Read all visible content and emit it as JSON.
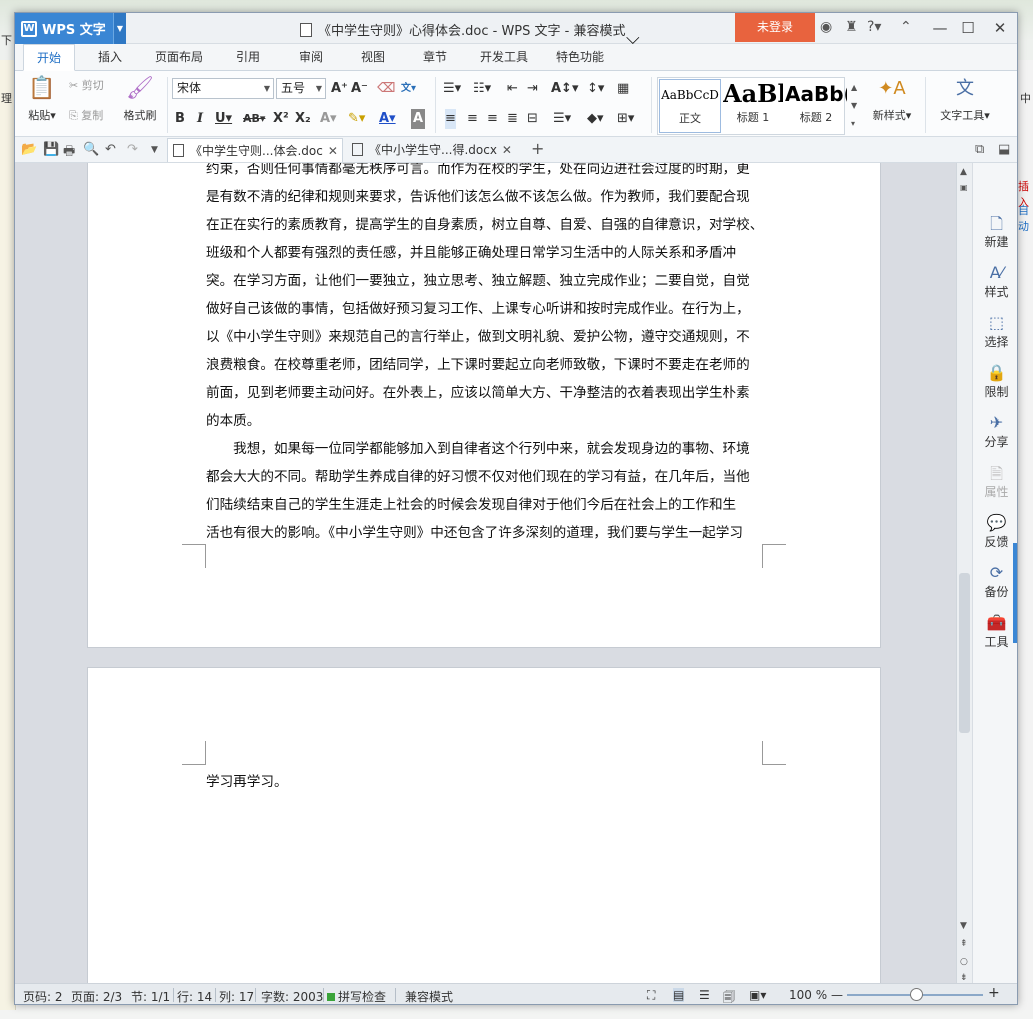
{
  "app": {
    "name": "WPS 文字",
    "window_title": "《中学生守则》心得体会.doc - WPS 文字 - 兼容模式",
    "login_label": "未登录"
  },
  "ribbon_tabs": [
    "开始",
    "插入",
    "页面布局",
    "引用",
    "审阅",
    "视图",
    "章节",
    "开发工具",
    "特色功能"
  ],
  "ribbon": {
    "paste": "粘贴",
    "cut": "剪切",
    "copy": "复制",
    "format_painter": "格式刷",
    "font_name": "宋体",
    "font_size": "五号",
    "styles": [
      {
        "sample": "AaBbCcD",
        "label": "正文"
      },
      {
        "sample": "AaBl",
        "label": "标题 1"
      },
      {
        "sample": "AaBb(",
        "label": "标题 2"
      }
    ],
    "new_style": "新样式",
    "text_tools": "文字工具"
  },
  "doc_tabs": [
    {
      "label": "《中学生守则...体会.doc"
    },
    {
      "label": "《中小学生守...得.docx"
    }
  ],
  "document": {
    "page1_lines": [
      "约束，否则任何事情都毫无秩序可言。而作为在校的学生，处在向迈进社会过度的时期，更",
      "是有数不清的纪律和规则来要求，告诉他们该怎么做不该怎么做。作为教师，我们要配合现",
      "在正在实行的素质教育，提高学生的自身素质，树立自尊、自爱、自强的自律意识，对学校、",
      "班级和个人都要有强烈的责任感，并且能够正确处理日常学习生活中的人际关系和矛盾冲",
      "突。在学习方面，让他们一要独立，独立思考、独立解题、独立完成作业；二要自觉，自觉",
      "做好自己该做的事情，包括做好预习复习工作、上课专心听讲和按时完成作业。在行为上，",
      "以《中小学生守则》来规范自己的言行举止，做到文明礼貌、爱护公物，遵守交通规则，不",
      "浪费粮食。在校尊重老师，团结同学，上下课时要起立向老师致敬，下课时不要走在老师的",
      "前面，见到老师要主动问好。在外表上，应该以简单大方、干净整洁的衣着表现出学生朴素",
      "的本质。",
      "　　我想，如果每一位同学都能够加入到自律者这个行列中来，就会发现身边的事物、环境",
      "都会大大的不同。帮助学生养成自律的好习惯不仅对他们现在的学习有益，在几年后，当他",
      "们陆续结束自己的学生生涯走上社会的时候会发现自律对于他们今后在社会上的工作和生",
      "活也有很大的影响。《中小学生守则》中还包含了许多深刻的道理，我们要与学生一起学习"
    ],
    "page2_lines": [
      "学习再学习。"
    ]
  },
  "side_panel": [
    "新建",
    "样式",
    "选择",
    "限制",
    "分享",
    "属性",
    "反馈",
    "备份",
    "工具"
  ],
  "status": {
    "page_code": "页码: 2",
    "pages": "页面: 2/3",
    "section": "节: 1/1",
    "row": "行: 14",
    "col": "列: 17",
    "word_count": "字数: 2003",
    "spell_check": "拼写检查",
    "compat_mode": "兼容模式",
    "zoom": "100 %"
  },
  "background_fragments": {
    "left_top": "下",
    "left_ribbon": "理",
    "right_top": "中",
    "right_ribbon": "插入",
    "right_auto": "自动"
  },
  "colors": {
    "accent": "#3a86d4",
    "login": "#e8633e"
  }
}
